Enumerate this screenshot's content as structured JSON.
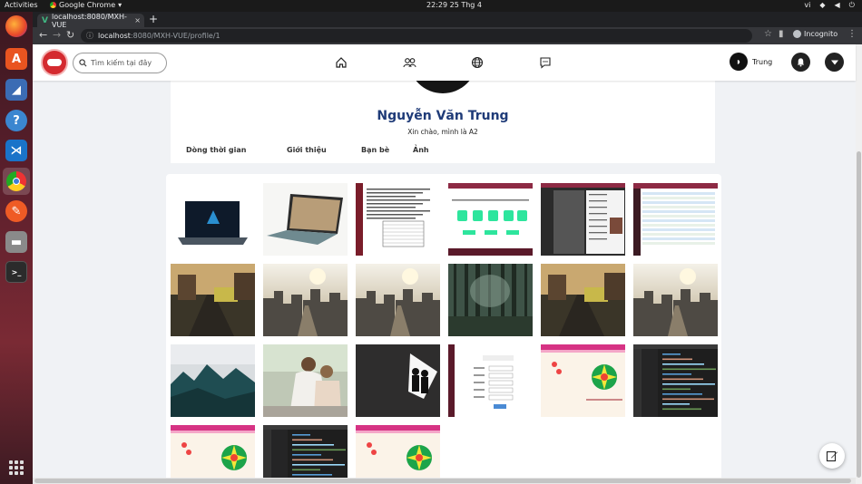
{
  "os": {
    "activities": "Activities",
    "app_name": "Google Chrome",
    "clock": "22:29  25 Thg 4",
    "lang": "vi",
    "tray_icons": [
      "network-icon",
      "volume-icon",
      "power-icon"
    ],
    "dock_items": [
      {
        "name": "firefox-icon"
      },
      {
        "name": "software-center-icon"
      },
      {
        "name": "wireshark-icon"
      },
      {
        "name": "help-icon"
      },
      {
        "name": "vscode-icon"
      },
      {
        "name": "chrome-icon"
      },
      {
        "name": "postman-icon"
      },
      {
        "name": "files-icon"
      },
      {
        "name": "terminal-icon"
      }
    ]
  },
  "browser": {
    "tab_title": "localhost:8080/MXH-VUE",
    "url_host": "localhost",
    "url_path": ":8080/MXH-VUE/profile/1",
    "incognito_label": "Incognito"
  },
  "app": {
    "search_placeholder": "Tìm kiếm tại đây",
    "nav_icons": [
      "home-icon",
      "friends-icon",
      "globe-icon",
      "messages-icon"
    ],
    "user_name": "Trung",
    "avatar_text": "Trung"
  },
  "profile": {
    "name": "Nguyễn Văn Trung",
    "bio": "Xin chào, mình là A2",
    "tabs": [
      "Dòng thời gian",
      "Giới thiệu",
      "Bạn bè",
      "Ảnh"
    ]
  },
  "gallery": {
    "photos": [
      {
        "kind": "laptop-dark"
      },
      {
        "kind": "laptop-silver"
      },
      {
        "kind": "document"
      },
      {
        "kind": "diagram-screenshot"
      },
      {
        "kind": "app-screenshot"
      },
      {
        "kind": "spreadsheet-screenshot"
      },
      {
        "kind": "street"
      },
      {
        "kind": "city"
      },
      {
        "kind": "city"
      },
      {
        "kind": "forest"
      },
      {
        "kind": "street"
      },
      {
        "kind": "city"
      },
      {
        "kind": "mountain-fog"
      },
      {
        "kind": "people"
      },
      {
        "kind": "dark-figures"
      },
      {
        "kind": "form-screenshot"
      },
      {
        "kind": "wheel-screenshot"
      },
      {
        "kind": "code-screenshot"
      },
      {
        "kind": "wheel-screenshot"
      },
      {
        "kind": "code-screenshot"
      },
      {
        "kind": "wheel-screenshot"
      }
    ]
  }
}
